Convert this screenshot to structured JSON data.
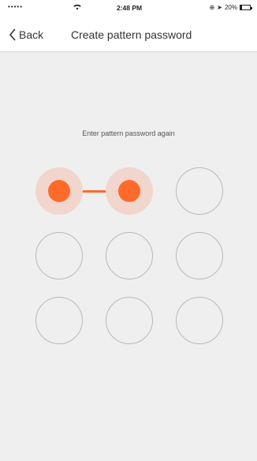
{
  "status_bar": {
    "signal": "•••••",
    "time": "2:48 PM",
    "battery_text": "20%",
    "battery_level": 0.2
  },
  "nav": {
    "back_label": "Back",
    "title": "Create pattern password"
  },
  "pattern": {
    "prompt": "Enter pattern password again",
    "accent_color": "#ff6a2a",
    "highlight_color": "#f2d5cc",
    "selected_nodes": [
      0,
      1
    ],
    "nodes": [
      {
        "id": 1,
        "selected": true
      },
      {
        "id": 2,
        "selected": true
      },
      {
        "id": 3,
        "selected": false
      },
      {
        "id": 4,
        "selected": false
      },
      {
        "id": 5,
        "selected": false
      },
      {
        "id": 6,
        "selected": false
      },
      {
        "id": 7,
        "selected": false
      },
      {
        "id": 8,
        "selected": false
      },
      {
        "id": 9,
        "selected": false
      }
    ]
  }
}
